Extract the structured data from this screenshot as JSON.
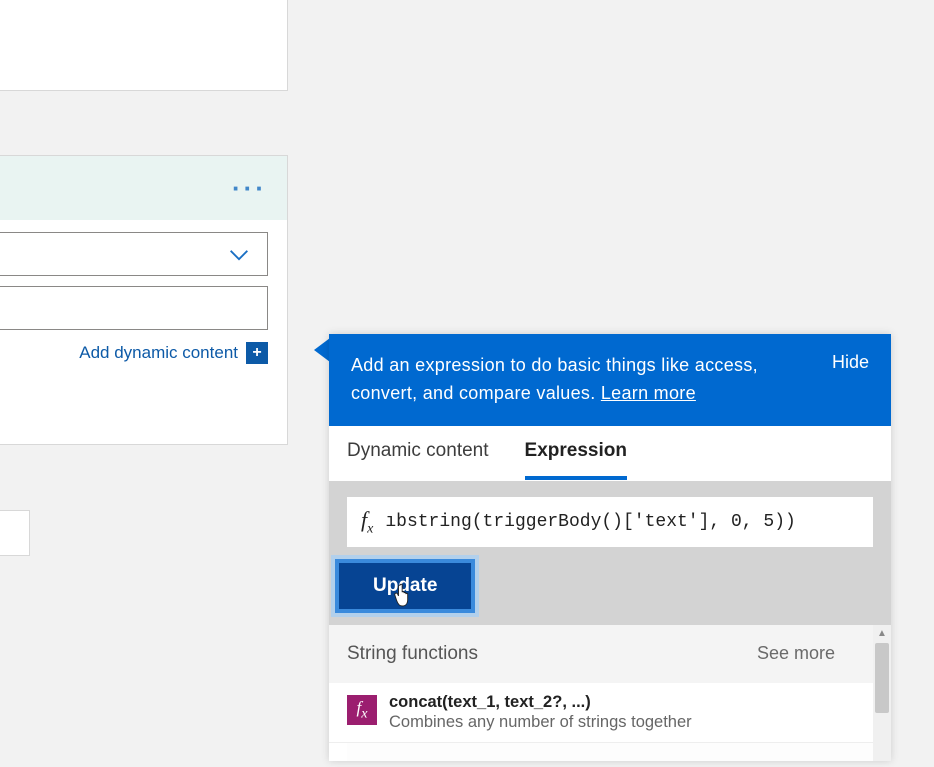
{
  "left_panel": {
    "add_dynamic_label": "Add dynamic content"
  },
  "expression_panel": {
    "header_text": "Add an expression to do basic things like access, convert, and compare values.",
    "learn_more_label": "Learn more",
    "hide_label": "Hide",
    "tabs": {
      "dynamic": "Dynamic content",
      "expression": "Expression"
    },
    "expression_value": "ıbstring(triggerBody()['text'], 0, 5))",
    "update_button": "Update",
    "group_title": "String functions",
    "see_more_label": "See more",
    "functions": [
      {
        "signature": "concat(text_1, text_2?, ...)",
        "description": "Combines any number of strings together"
      }
    ]
  }
}
